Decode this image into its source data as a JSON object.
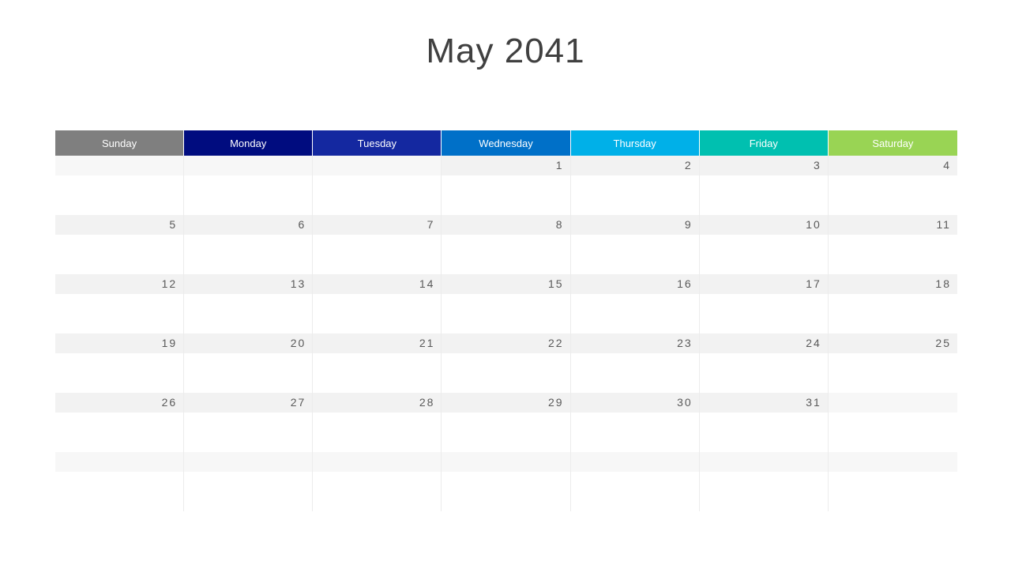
{
  "title": "May 2041",
  "days": [
    {
      "label": "Sunday",
      "color": "#7f7f7f"
    },
    {
      "label": "Monday",
      "color": "#000c7f"
    },
    {
      "label": "Tuesday",
      "color": "#1428a0"
    },
    {
      "label": "Wednesday",
      "color": "#0070c8"
    },
    {
      "label": "Thursday",
      "color": "#00b0e8"
    },
    {
      "label": "Friday",
      "color": "#00c0b0"
    },
    {
      "label": "Saturday",
      "color": "#99d454"
    }
  ],
  "weeks": [
    [
      "",
      "",
      "",
      "1",
      "2",
      "3",
      "4"
    ],
    [
      "5",
      "6",
      "7",
      "8",
      "9",
      "10",
      "11"
    ],
    [
      "12",
      "13",
      "14",
      "15",
      "16",
      "17",
      "18"
    ],
    [
      "19",
      "20",
      "21",
      "22",
      "23",
      "24",
      "25"
    ],
    [
      "26",
      "27",
      "28",
      "29",
      "30",
      "31",
      ""
    ],
    [
      "",
      "",
      "",
      "",
      "",
      "",
      ""
    ]
  ]
}
